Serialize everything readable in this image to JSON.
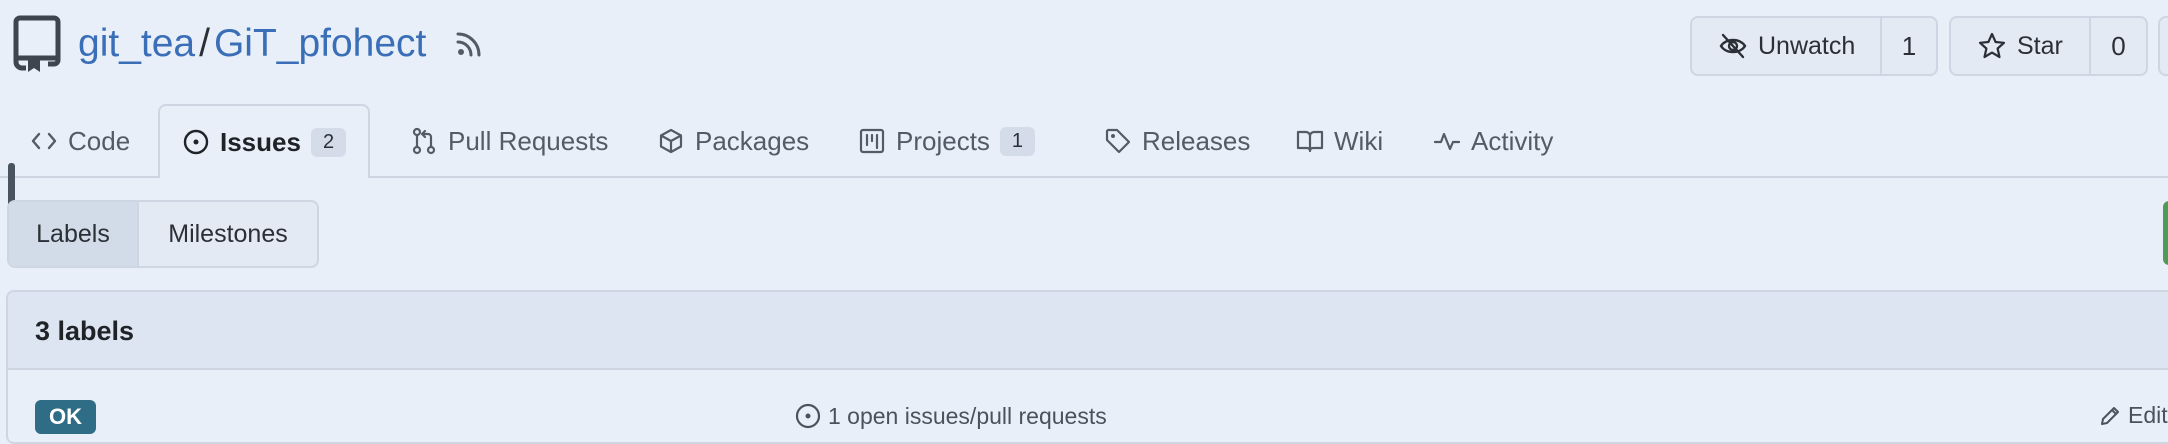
{
  "header": {
    "owner": "git_tea",
    "separator": "/",
    "repo": "GiT_pfohect"
  },
  "actions": {
    "watch_label": "Unwatch",
    "watch_count": "1",
    "star_label": "Star",
    "star_count": "0"
  },
  "tabs": [
    {
      "label": "Code",
      "icon": "code-icon"
    },
    {
      "label": "Issues",
      "icon": "issue-opened-icon",
      "badge": "2",
      "active": true
    },
    {
      "label": "Pull Requests",
      "icon": "pull-request-icon"
    },
    {
      "label": "Packages",
      "icon": "package-icon"
    },
    {
      "label": "Projects",
      "icon": "project-icon",
      "badge": "1"
    },
    {
      "label": "Releases",
      "icon": "tag-icon"
    },
    {
      "label": "Wiki",
      "icon": "book-icon"
    },
    {
      "label": "Activity",
      "icon": "pulse-icon"
    }
  ],
  "subnav": {
    "labels": "Labels",
    "milestones": "Milestones"
  },
  "labels_section": {
    "count_text": "3 labels",
    "items": [
      {
        "name": "OK",
        "color": "#2f6c86",
        "issues_text": "1 open issues/pull requests",
        "edit_label": "Edit"
      }
    ]
  },
  "colors": {
    "link": "#3a6fb8",
    "background": "#e8eff9",
    "border": "#cdd6e2",
    "accent_green": "#4f9a56"
  }
}
